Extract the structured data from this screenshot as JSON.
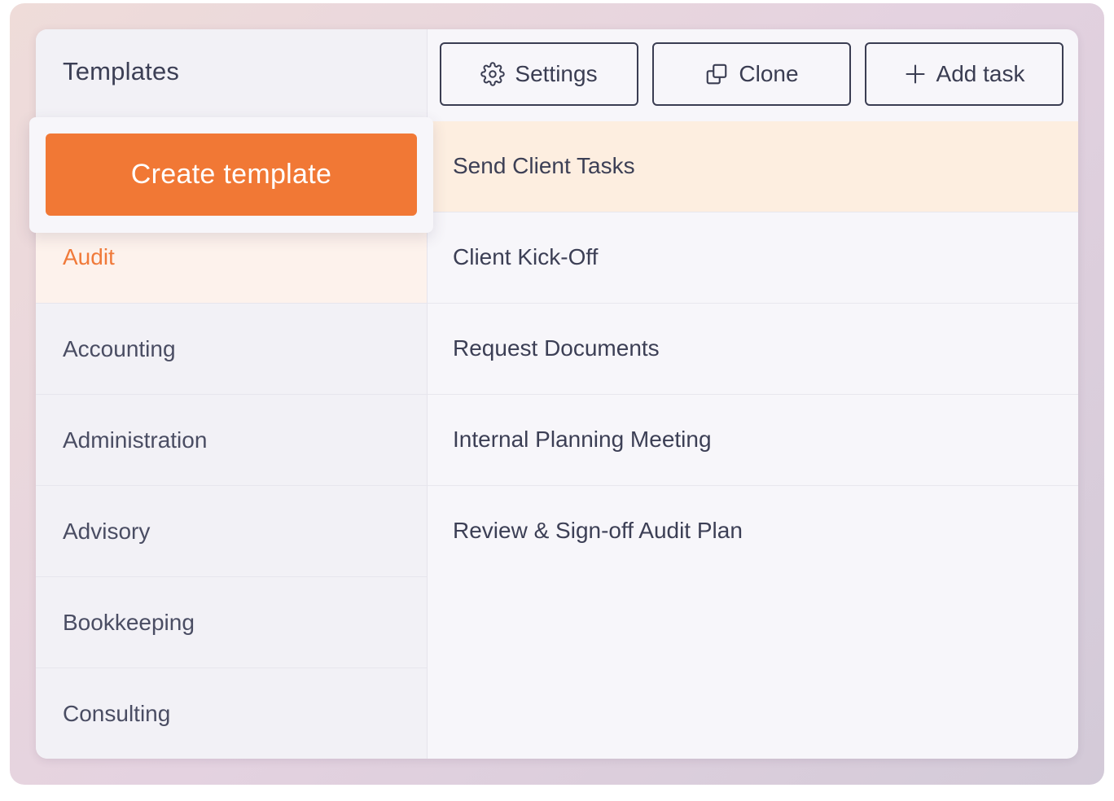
{
  "sidebar": {
    "title": "Templates",
    "categories": [
      {
        "label": "Audit",
        "active": true
      },
      {
        "label": "Accounting",
        "active": false
      },
      {
        "label": "Administration",
        "active": false
      },
      {
        "label": "Advisory",
        "active": false
      },
      {
        "label": "Bookkeeping",
        "active": false
      },
      {
        "label": "Consulting",
        "active": false
      }
    ]
  },
  "create_template": {
    "label": "Create template"
  },
  "toolbar": {
    "settings_label": "Settings",
    "clone_label": "Clone",
    "add_task_label": "Add task"
  },
  "tasks": [
    {
      "label": "Send Client Tasks",
      "selected": true
    },
    {
      "label": "Client Kick-Off",
      "selected": false
    },
    {
      "label": "Request Documents",
      "selected": false
    },
    {
      "label": "Internal Planning Meeting",
      "selected": false
    },
    {
      "label": "Review & Sign-off Audit Plan",
      "selected": false
    }
  ],
  "colors": {
    "accent": "#f17835",
    "active_category_bg": "#fdf2ec",
    "selected_task_bg": "#fdeee0",
    "text": "#3c3f55"
  },
  "icons": {
    "settings": "gear-icon",
    "clone": "copy-icon",
    "add_task": "plus-icon"
  }
}
